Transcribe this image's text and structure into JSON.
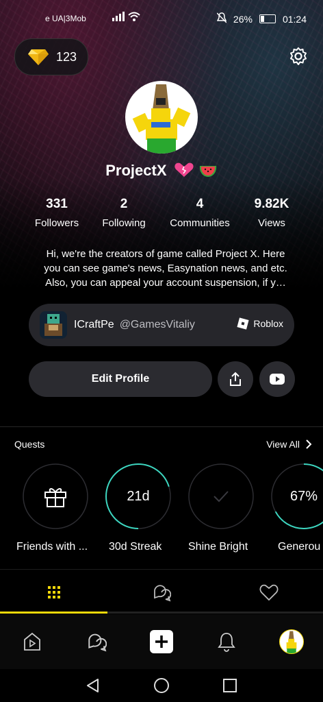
{
  "status_bar": {
    "carrier": "e UA|3Mob",
    "signal": "ııl",
    "battery": "26%",
    "time": "01:24"
  },
  "gems": {
    "count": "123",
    "icon": "diamond-icon"
  },
  "profile": {
    "username": "ProjectX",
    "emojis": [
      "pink-broken-heart",
      "watermelon-slice"
    ],
    "stats": [
      {
        "value": "331",
        "label": "Followers"
      },
      {
        "value": "2",
        "label": "Following"
      },
      {
        "value": "4",
        "label": "Communities"
      },
      {
        "value": "9.82K",
        "label": "Views"
      }
    ],
    "bio_lines": [
      "Hi, we're the creators of game called Project X. Here",
      "you can see game's news, Easynation news, and etc.",
      "Also, you can appeal your account suspension, if y…"
    ]
  },
  "linked_account": {
    "name": "ICraftPe",
    "handle": "@GamesVitaliy",
    "platform": "Roblox"
  },
  "actions": {
    "edit_label": "Edit Profile",
    "share_icon": "share-icon",
    "youtube_icon": "youtube-icon"
  },
  "quests": {
    "title": "Quests",
    "view_all": "View All",
    "items": [
      {
        "label": "Friends with ...",
        "center": "",
        "progress": 0,
        "icon": "gift-icon"
      },
      {
        "label": "30d Streak",
        "center": "21d",
        "progress": 0.7
      },
      {
        "label": "Shine Bright",
        "center": "",
        "progress": 0,
        "icon": "check-icon"
      },
      {
        "label": "Generou",
        "center": "67%",
        "progress": 0.67
      }
    ]
  },
  "tabs": [
    {
      "icon": "grid-icon",
      "active": true
    },
    {
      "icon": "chat-icon",
      "active": false
    },
    {
      "icon": "heart-icon",
      "active": false
    }
  ],
  "bottom_nav": [
    "play-icon",
    "chat-icon",
    "plus-icon",
    "bell-icon",
    "profile-avatar"
  ],
  "colors": {
    "accent": "#f5d90a",
    "ring": "#3dd6c0",
    "card": "#26262b"
  }
}
